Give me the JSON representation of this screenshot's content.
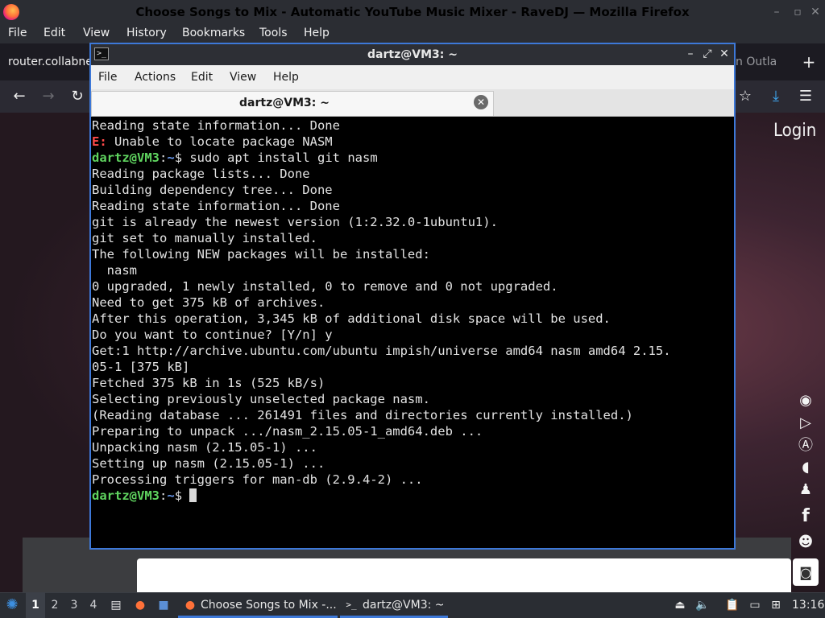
{
  "firefox": {
    "title": "Choose Songs to Mix - Automatic YouTube Music Mixer - RaveDJ — Mozilla Firefox",
    "menu": [
      "File",
      "Edit",
      "View",
      "History",
      "Bookmarks",
      "Tools",
      "Help"
    ],
    "tab_left_text": "router.collabne",
    "tab_right_text": "n Outla",
    "new_tab_icon": "+",
    "page": {
      "login_label": "Login",
      "social_icons": [
        "rave-icon",
        "google-play-icon",
        "app-store-icon",
        "patreon-icon",
        "tshirt-icon",
        "facebook-icon",
        "reddit-icon",
        "discord-icon"
      ]
    }
  },
  "terminal": {
    "title": "dartz@VM3: ~",
    "menu": [
      "File",
      "Actions",
      "Edit",
      "View",
      "Help"
    ],
    "tab_label": "dartz@VM3: ~",
    "lines": [
      {
        "parts": [
          {
            "t": "Reading state information... Done"
          }
        ]
      },
      {
        "parts": [
          {
            "t": "E:",
            "c": "red"
          },
          {
            "t": " Unable to locate package NASM"
          }
        ]
      },
      {
        "parts": [
          {
            "t": "dartz@VM3",
            "c": "green"
          },
          {
            "t": ":"
          },
          {
            "t": "~",
            "c": "blue"
          },
          {
            "t": "$ sudo apt install git nasm"
          }
        ]
      },
      {
        "parts": [
          {
            "t": "Reading package lists... Done"
          }
        ]
      },
      {
        "parts": [
          {
            "t": "Building dependency tree... Done"
          }
        ]
      },
      {
        "parts": [
          {
            "t": "Reading state information... Done"
          }
        ]
      },
      {
        "parts": [
          {
            "t": "git is already the newest version (1:2.32.0-1ubuntu1)."
          }
        ]
      },
      {
        "parts": [
          {
            "t": "git set to manually installed."
          }
        ]
      },
      {
        "parts": [
          {
            "t": "The following NEW packages will be installed:"
          }
        ]
      },
      {
        "parts": [
          {
            "t": "  nasm"
          }
        ]
      },
      {
        "parts": [
          {
            "t": "0 upgraded, 1 newly installed, 0 to remove and 0 not upgraded."
          }
        ]
      },
      {
        "parts": [
          {
            "t": "Need to get 375 kB of archives."
          }
        ]
      },
      {
        "parts": [
          {
            "t": "After this operation, 3,345 kB of additional disk space will be used."
          }
        ]
      },
      {
        "parts": [
          {
            "t": "Do you want to continue? [Y/n] y"
          }
        ]
      },
      {
        "parts": [
          {
            "t": "Get:1 http://archive.ubuntu.com/ubuntu impish/universe amd64 nasm amd64 2.15."
          }
        ]
      },
      {
        "parts": [
          {
            "t": "05-1 [375 kB]"
          }
        ]
      },
      {
        "parts": [
          {
            "t": "Fetched 375 kB in 1s (525 kB/s)"
          }
        ]
      },
      {
        "parts": [
          {
            "t": "Selecting previously unselected package nasm."
          }
        ]
      },
      {
        "parts": [
          {
            "t": "(Reading database ... 261491 files and directories currently installed.)"
          }
        ]
      },
      {
        "parts": [
          {
            "t": "Preparing to unpack .../nasm_2.15.05-1_amd64.deb ..."
          }
        ]
      },
      {
        "parts": [
          {
            "t": "Unpacking nasm (2.15.05-1) ..."
          }
        ]
      },
      {
        "parts": [
          {
            "t": "Setting up nasm (2.15.05-1) ..."
          }
        ]
      },
      {
        "parts": [
          {
            "t": "Processing triggers for man-db (2.9.4-2) ..."
          }
        ]
      },
      {
        "parts": [
          {
            "t": "dartz@VM3",
            "c": "green"
          },
          {
            "t": ":"
          },
          {
            "t": "~",
            "c": "blue"
          },
          {
            "t": "$ "
          }
        ],
        "cursor": true
      }
    ]
  },
  "taskbar": {
    "workspaces": [
      "1",
      "2",
      "3",
      "4"
    ],
    "firefox_task": "Choose Songs to Mix -...",
    "terminal_task": "dartz@VM3: ~",
    "clock": "13:16"
  },
  "colors": {
    "prompt_user": "#5fd35f",
    "prompt_path": "#6b9cf3",
    "error": "#ff4a4a",
    "active_window_border": "#3d78d8"
  }
}
